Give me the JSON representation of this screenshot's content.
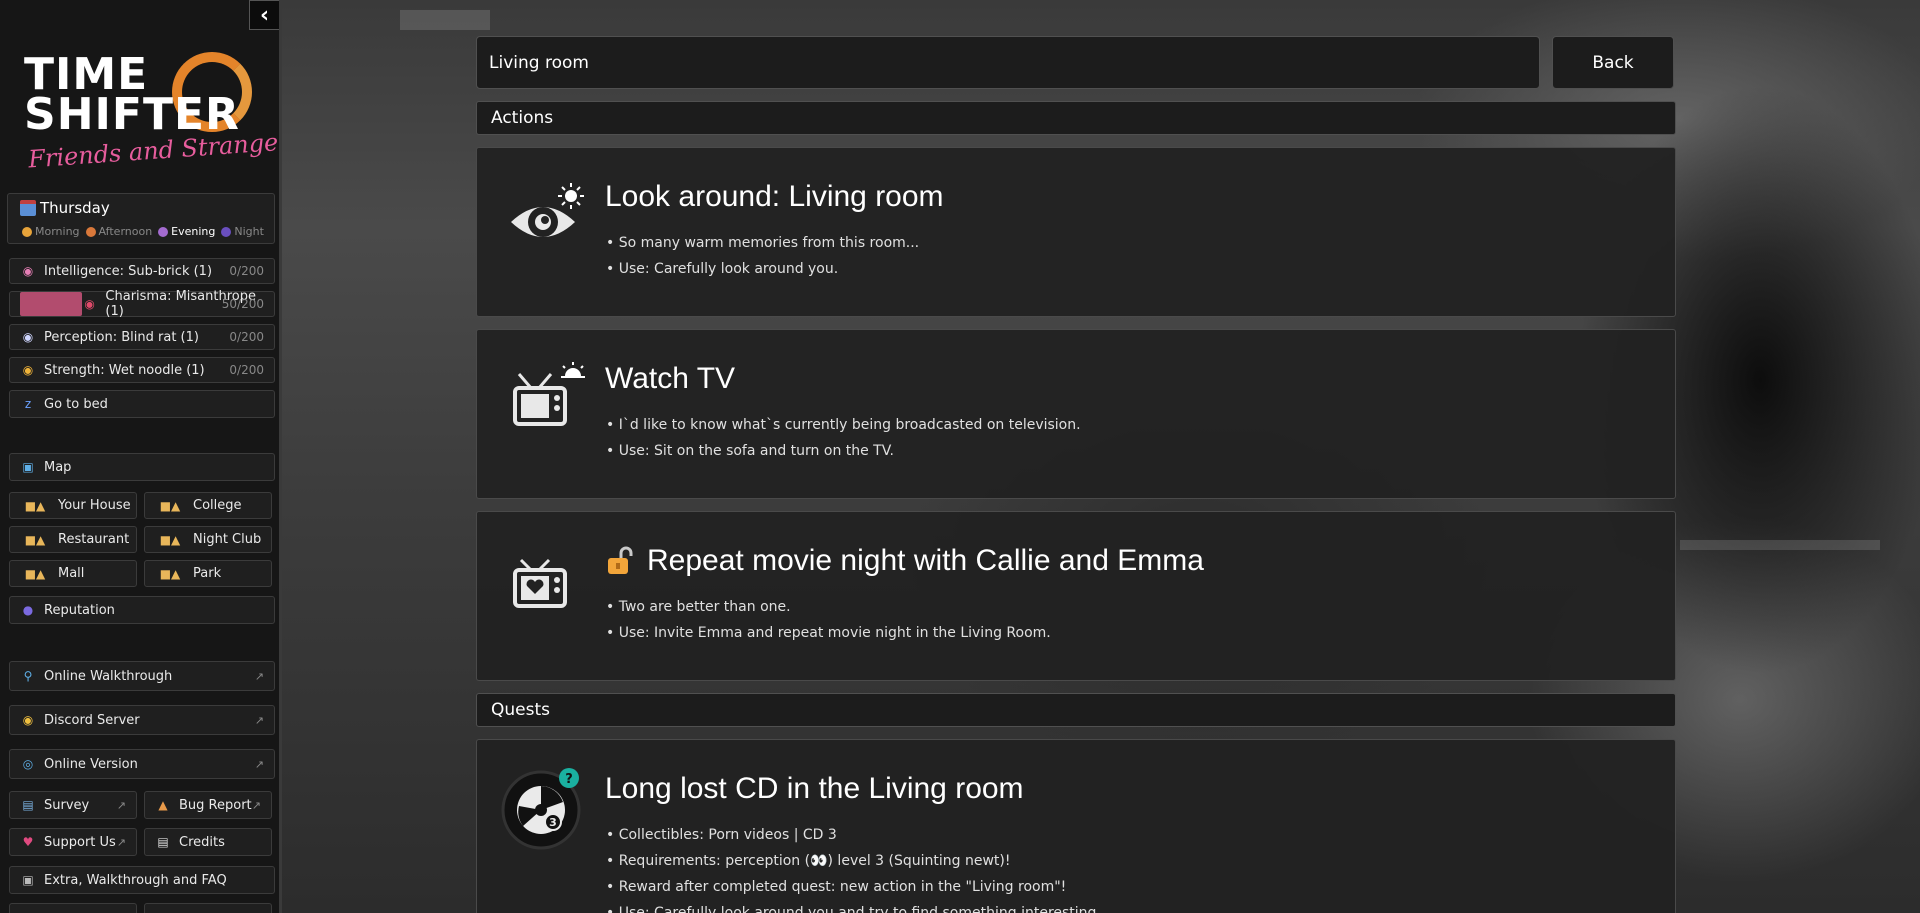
{
  "sidebar": {
    "collapse_icon": "chevron-left-icon",
    "logo": {
      "line1": "TIME",
      "line2": "SHIFTER",
      "line3": "Friends and Strangers"
    },
    "day": {
      "name": "Thursday",
      "times": [
        {
          "label": "Morning",
          "color": "#e8a43a",
          "active": false
        },
        {
          "label": "Afternoon",
          "color": "#d9783a",
          "active": false
        },
        {
          "label": "Evening",
          "color": "#a46bd0",
          "active": true
        },
        {
          "label": "Night",
          "color": "#6a4fbf",
          "active": false
        }
      ]
    },
    "stats": [
      {
        "icon": "brain-icon",
        "label": "Intelligence: Sub-brick (1)",
        "value": "0/200",
        "progress": 0
      },
      {
        "icon": "lips-icon",
        "label": "Charisma: Misanthrope (1)",
        "value": "50/200",
        "progress": 0.25
      },
      {
        "icon": "eyes-icon",
        "label": "Perception: Blind rat (1)",
        "value": "0/200",
        "progress": 0
      },
      {
        "icon": "muscle-icon",
        "label": "Strength: Wet noodle (1)",
        "value": "0/200",
        "progress": 0
      }
    ],
    "go_to_bed": "Go to bed",
    "map": "Map",
    "locations": [
      "Your House",
      "College",
      "Restaurant",
      "Night Club",
      "Mall",
      "Park"
    ],
    "reputation": "Reputation",
    "links": {
      "walkthrough": "Online Walkthrough",
      "discord": "Discord Server",
      "online_version": "Online Version",
      "survey": "Survey",
      "bug_report": "Bug Report",
      "support": "Support Us",
      "credits": "Credits",
      "extra": "Extra, Walkthrough and FAQ"
    }
  },
  "main": {
    "location": "Living room",
    "back_label": "Back",
    "actions_header": "Actions",
    "actions": [
      {
        "icon": "eye-icon",
        "title": "Look around: Living room",
        "lines": [
          "So many warm memories from this room...",
          "Use: Carefully look around you."
        ]
      },
      {
        "icon": "tv-icon",
        "title": "Watch TV",
        "lines": [
          "I`d like to know what`s currently being broadcasted on television.",
          "Use: Sit on the sofa and turn on the TV."
        ]
      },
      {
        "icon": "tv-heart-icon",
        "title": "Repeat movie night with Callie and Emma",
        "lines": [
          "Two are better than one.",
          "Use: Invite Emma and repeat movie night in the Living Room."
        ]
      }
    ],
    "quests_header": "Quests",
    "quest": {
      "icon": "cd-icon",
      "badge": "?",
      "cd_number": "3",
      "title": "Long lost CD in the Living room",
      "lines": [
        "Collectibles: Porn videos | CD 3",
        "Requirements: perception (👀) level 3 (Squinting newt)!",
        "Reward after completed quest: new action in the \"Living room\"!",
        "Use: Carefully look around you and try to find something interesting."
      ]
    }
  }
}
